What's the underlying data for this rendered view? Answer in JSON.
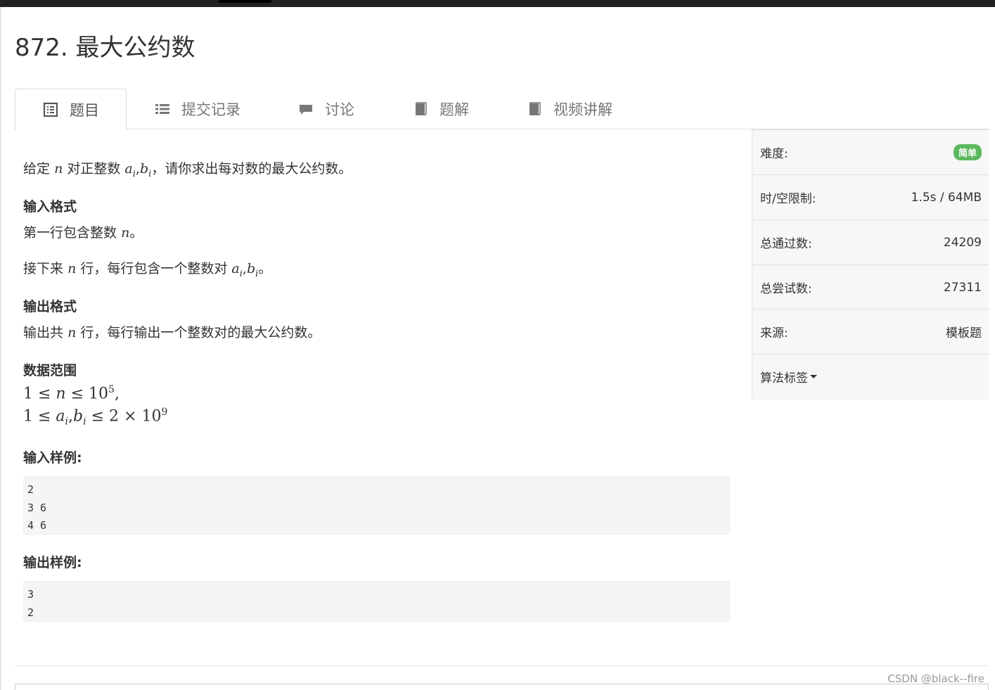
{
  "problem": {
    "title": "872. 最大公约数"
  },
  "tabs": [
    {
      "label": "题目",
      "icon": "document-list-icon",
      "active": true
    },
    {
      "label": "提交记录",
      "icon": "list-icon",
      "active": false
    },
    {
      "label": "讨论",
      "icon": "comment-icon",
      "active": false
    },
    {
      "label": "题解",
      "icon": "book-icon",
      "active": false
    },
    {
      "label": "视频讲解",
      "icon": "book-icon",
      "active": false
    }
  ],
  "statement": {
    "intro_pre": "给定",
    "intro_var_n": "n",
    "intro_mid": "对正整数",
    "intro_ai": "a",
    "intro_sub_i": "i",
    "intro_comma": ",",
    "intro_bi": "b",
    "intro_post": "，请你求出每对数的最大公约数。",
    "input_heading": "输入格式",
    "input_line1_pre": "第一行包含整数",
    "input_line1_post": "。",
    "input_line2_pre": "接下来",
    "input_line2_mid": "行，每行包含一个整数对",
    "input_line2_post": "。",
    "output_heading": "输出格式",
    "output_line_pre": "输出共",
    "output_line_post": "行，每行输出一个整数对的最大公约数。",
    "range_heading": "数据范围",
    "range1_pre": "1 ≤ ",
    "range1_n": "n",
    "range1_mid": " ≤ 10",
    "range1_exp": "5",
    "range1_post": ",",
    "range2_pre": "1 ≤ ",
    "range2_mid": " ≤ 2 × 10",
    "range2_exp": "9",
    "sample_input_heading": "输入样例:",
    "sample_input": "2\n3 6\n4 6",
    "sample_output_heading": "输出样例:",
    "sample_output": "3\n2"
  },
  "sidebar": {
    "difficulty_label": "难度:",
    "difficulty_value": "简单",
    "limit_label": "时/空限制:",
    "limit_value": "1.5s / 64MB",
    "accepted_label": "总通过数:",
    "accepted_value": "24209",
    "attempts_label": "总尝试数:",
    "attempts_value": "27311",
    "source_label": "来源:",
    "source_value": "模板题",
    "tags_label": "算法标签"
  },
  "watermark": "CSDN @black--fire",
  "colors": {
    "badge_green": "#5cb85c",
    "topbar": "#222222",
    "sidebar_bg": "#f7f7f7"
  }
}
